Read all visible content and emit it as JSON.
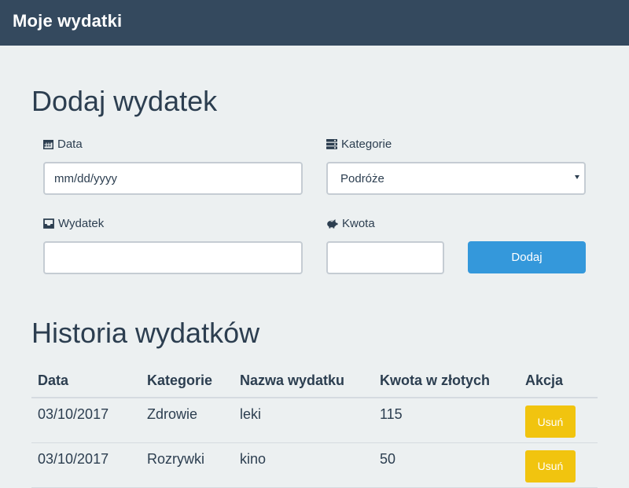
{
  "navbar": {
    "brand": "Moje wydatki"
  },
  "form": {
    "title": "Dodaj wydatek",
    "date_label": "Data",
    "date_placeholder": "mm/dd/yyyy",
    "category_label": "Kategorie",
    "category_selected": "Podróże",
    "expense_label": "Wydatek",
    "expense_value": "",
    "amount_label": "Kwota",
    "amount_value": "",
    "submit_label": "Dodaj"
  },
  "history": {
    "title": "Historia wydatków",
    "columns": [
      "Data",
      "Kategorie",
      "Nazwa wydatku",
      "Kwota w złotych",
      "Akcja"
    ],
    "rows": [
      {
        "date": "03/10/2017",
        "category": "Zdrowie",
        "name": "leki",
        "amount": "115",
        "action": "Usuń"
      },
      {
        "date": "03/10/2017",
        "category": "Rozrywki",
        "name": "kino",
        "amount": "50",
        "action": "Usuń"
      }
    ]
  },
  "colors": {
    "navbar": "#34495e",
    "background": "#ecf0f1",
    "primary": "#3498db",
    "warning": "#f1c40f",
    "text": "#2c3e50"
  },
  "icons": {
    "date": "calendar-icon",
    "category": "server-icon",
    "expense": "inbox-icon",
    "amount": "piggy-bank-icon"
  }
}
